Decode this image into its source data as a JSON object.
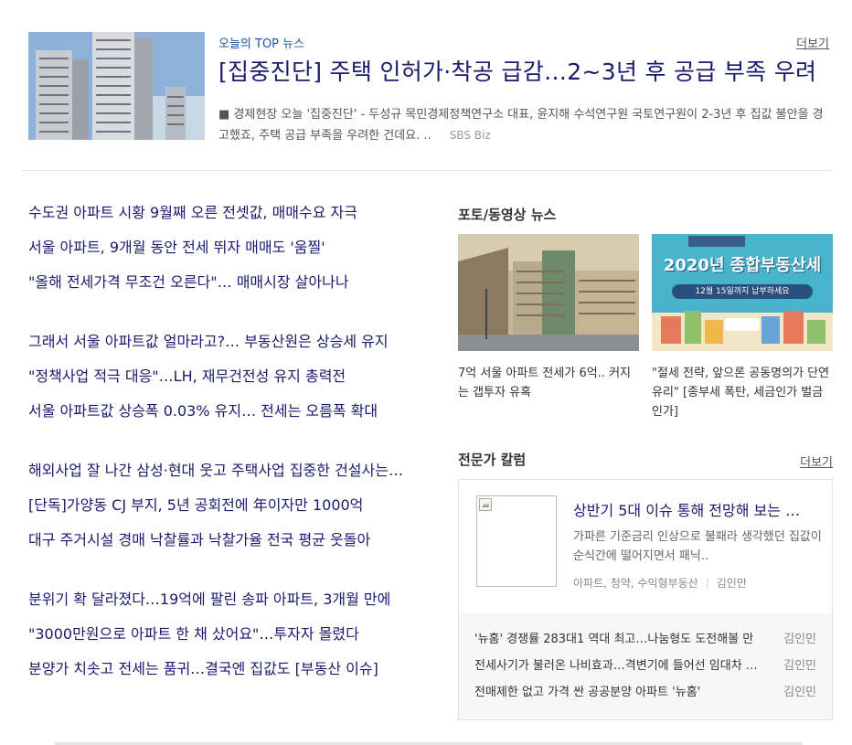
{
  "top_news": {
    "label": "오늘의 TOP 뉴스",
    "more": "더보기",
    "title": "[집중진단] 주택 인허가·착공 급감…2~3년 후 공급 부족 우려",
    "desc": "■ 경제현장 오늘 '집중진단' - 두성규 목민경제정책연구소 대표, 윤지해 수석연구원  국토연구원이 2-3년 후 집값 불안을 경고했죠, 주택 공급 부족을 우려한 건데요. ..",
    "source": "SBS Biz"
  },
  "left_news": [
    [
      "수도권 아파트 시황 9월째 오른 전셋값, 매매수요 자극",
      "서울 아파트, 9개월 동안 전세 뛰자 매매도 '움찔'",
      "\"올해 전세가격 무조건 오른다\"… 매매시장 살아나나"
    ],
    [
      "그래서 서울 아파트값 얼마라고?… 부동산원은 상승세 유지",
      "\"정책사업 적극 대응\"…LH, 재무건전성 유지 총력전",
      "서울 아파트값 상승폭 0.03% 유지… 전세는 오름폭 확대"
    ],
    [
      "해외사업 잘 나간 삼성·현대 웃고 주택사업 집중한 건설사는 울고",
      "[단독]가양동 CJ 부지, 5년 공회전에 年이자만 1000억",
      "대구 주거시설 경매 낙찰률과 낙찰가율 전국 평균 웃돌아"
    ],
    [
      "분위기 확 달라졌다…19억에 팔린 송파 아파트, 3개월 만에",
      "\"3000만원으로 아파트 한 채 샀어요\"…투자자 몰렸다",
      "분양가 치솟고 전세는 품귀…결국엔 집값도 [부동산 이슈]"
    ]
  ],
  "photo_section": {
    "title": "포토/동영상 뉴스",
    "items": [
      {
        "caption": "7억 서울 아파트 전세가 6억.. 커지는 갭투자 유혹"
      },
      {
        "caption": "\"절세 전략, 앞으론 공동명의가 단연 유리\" [종부세 폭탄, 세금인가 벌금인가]",
        "banner_title": "2020년 종합부동산세",
        "banner_sub": "12월 15일까지 납부하세요"
      }
    ]
  },
  "column_section": {
    "title": "전문가 칼럼",
    "more": "더보기",
    "featured": {
      "title": "상반기 5대 이슈 통해 전망해 보는 하반기 부동산 시장",
      "desc": "가파른 기준금리 인상으로 불패라 생각했던 집값이 순식간에 떨어지면서 패닉..",
      "tags": "아파트, 청약, 수익형부동산",
      "author": "김인만"
    },
    "list": [
      {
        "title": "'뉴홈' 경쟁률 283대1 역대 최고…나눔형도 도전해볼 만",
        "author": "김인민"
      },
      {
        "title": "전세사기가 불러온 나비효과…격변기에 들어선 임대차 시장",
        "author": "김인민"
      },
      {
        "title": "전매제한 없고 가격 싼 공공분양 아파트 '뉴홈'",
        "author": "김인민"
      }
    ]
  }
}
